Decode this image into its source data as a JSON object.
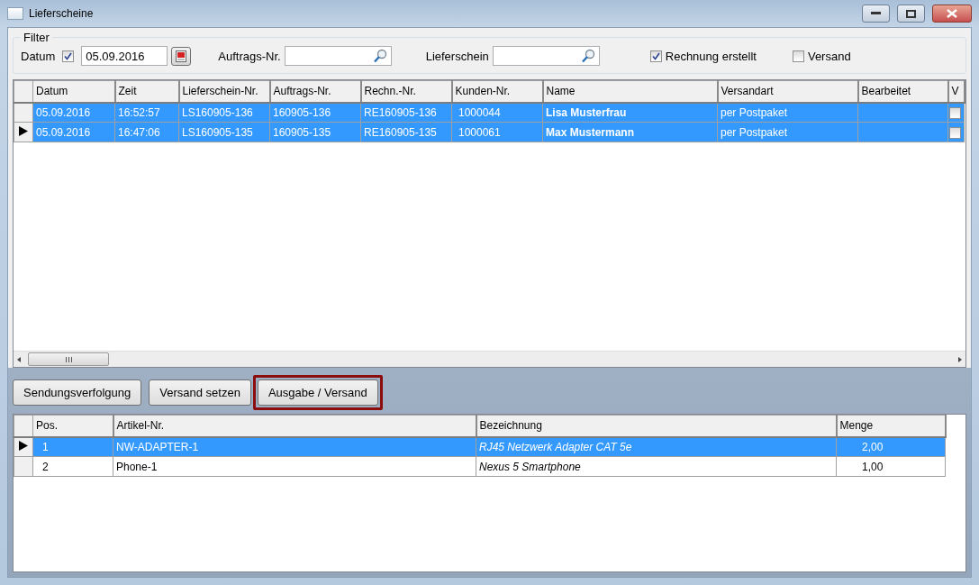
{
  "window": {
    "title": "Lieferscheine"
  },
  "filter": {
    "title": "Filter",
    "date_label": "Datum",
    "date_enabled": true,
    "date_value": "05.09.2016",
    "order_search": {
      "label": "Auftrags-Nr."
    },
    "delivery_search": {
      "label": "Lieferschein"
    },
    "checkboxes": [
      {
        "label": "Rechnung erstellt",
        "checked": true
      },
      {
        "label": "Versand",
        "checked": false
      }
    ]
  },
  "deliveries": {
    "columns": [
      {
        "label": "Datum",
        "kind": "text"
      },
      {
        "label": "Zeit",
        "kind": "text"
      },
      {
        "label": "Lieferschein-Nr.",
        "kind": "text"
      },
      {
        "label": "Auftrags-Nr.",
        "kind": "text"
      },
      {
        "label": "Rechn.-Nr.",
        "kind": "text"
      },
      {
        "label": "Kunden-Nr.",
        "kind": "customer"
      },
      {
        "label": "Name",
        "kind": "name"
      },
      {
        "label": "Versandart",
        "kind": "text"
      },
      {
        "label": "Bearbeitet",
        "kind": "text"
      },
      {
        "label": "V",
        "kind": "flag"
      }
    ],
    "rows": [
      {
        "selected": true,
        "current": false,
        "flag_checked": false,
        "cells": [
          "05.09.2016",
          "16:52:57",
          "LS160905-136",
          "160905-136",
          "RE160905-136",
          "1000044",
          "Lisa Musterfrau",
          "per Postpaket"
        ]
      },
      {
        "selected": true,
        "current": true,
        "flag_checked": false,
        "cells": [
          "05.09.2016",
          "16:47:06",
          "LS160905-135",
          "160905-135",
          "RE160905-135",
          "1000061",
          "Max Mustermann",
          "per Postpaket"
        ]
      }
    ]
  },
  "buttons": [
    {
      "label": "Sendungsverfolgung",
      "highlighted": false
    },
    {
      "label": "Versand setzen",
      "highlighted": false
    },
    {
      "label": "Ausgabe / Versand",
      "highlighted": true
    }
  ],
  "items": {
    "columns": [
      {
        "label": "Pos.",
        "kind": "position"
      },
      {
        "label": "Artikel-Nr.",
        "kind": "text"
      },
      {
        "label": "Bezeichnung",
        "kind": "description"
      },
      {
        "label": "Menge",
        "kind": "quantity"
      }
    ],
    "rows": [
      {
        "selected": true,
        "current": true,
        "cells": [
          "1",
          "NW-ADAPTER-1",
          "RJ45 Netzwerk Adapter CAT 5e",
          "2,00"
        ]
      },
      {
        "selected": false,
        "current": false,
        "cells": [
          "2",
          "Phone-1",
          "Nexus 5 Smartphone",
          "1,00"
        ]
      }
    ]
  }
}
